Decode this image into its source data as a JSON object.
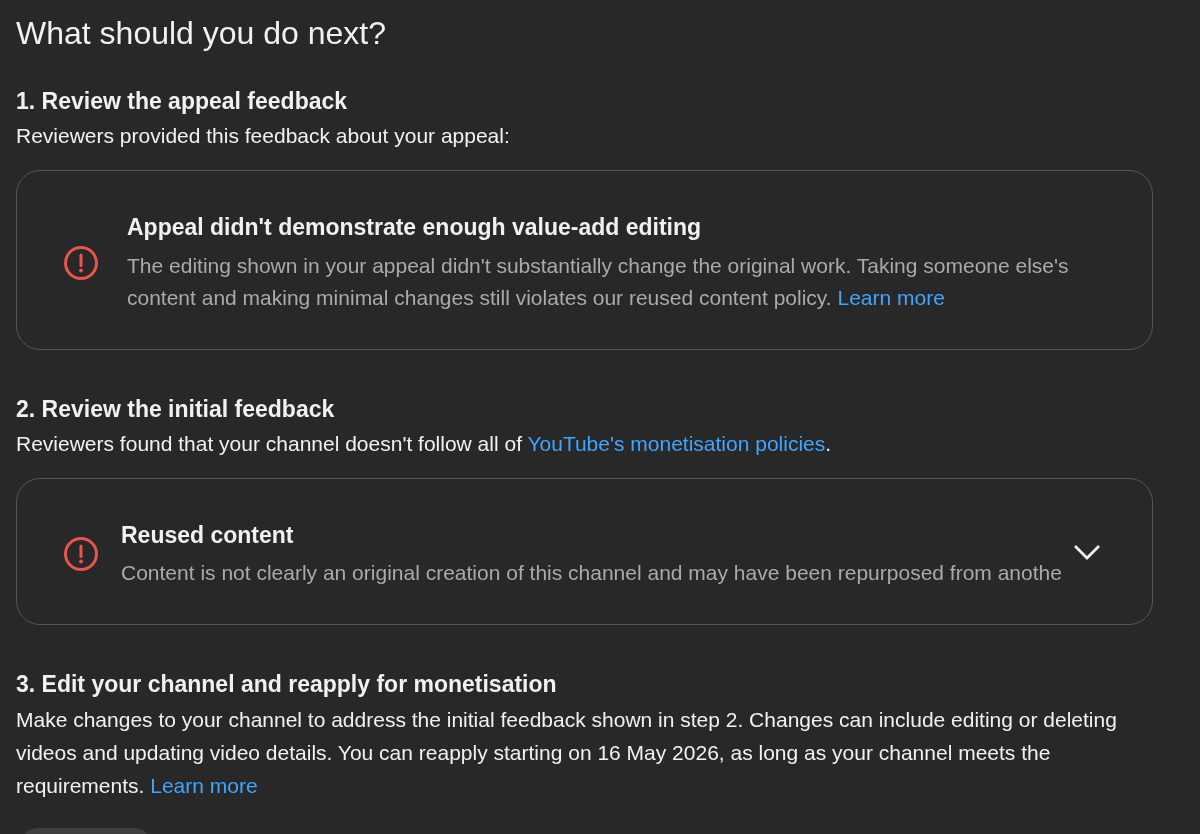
{
  "title": "What should you do next?",
  "steps": [
    {
      "heading": "1. Review the appeal feedback",
      "text": "Reviewers provided this feedback about your appeal:",
      "card": {
        "title": "Appeal didn't demonstrate enough value-add editing",
        "description": "The editing shown in your appeal didn't substantially change the original work. Taking someone else's content and making minimal changes still violates our reused content policy.",
        "link": "Learn more"
      }
    },
    {
      "heading": "2. Review the initial feedback",
      "text": "Reviewers found that your channel doesn't follow all of",
      "link": "YouTube's monetisation policies",
      "text_after": ".",
      "card": {
        "title": "Reused content",
        "description": "Content is not clearly an original creation of this channel and may have been repurposed from anothe",
        "expanded": false
      }
    },
    {
      "heading": "3. Edit your channel and reapply for monetisation",
      "text": "Make changes to your channel to address the initial feedback shown in step 2. Changes can include editing or deleting videos and updating video details. You can reapply starting on 16 May 2026, as long as your channel meets the requirements.",
      "link": "Learn more"
    }
  ]
}
